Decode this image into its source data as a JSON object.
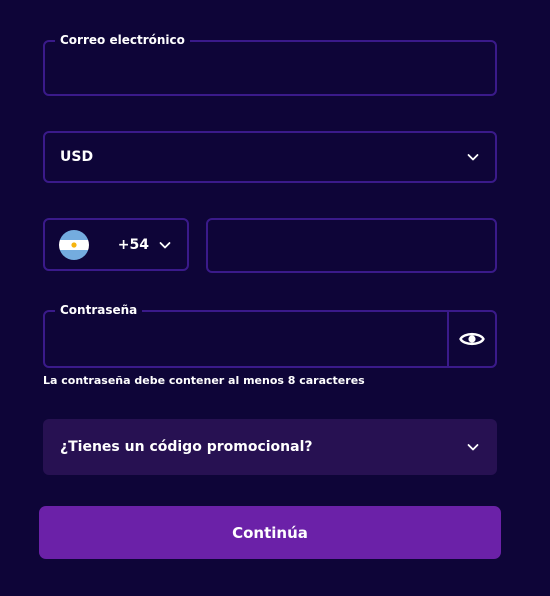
{
  "colors": {
    "background": "#0e0538",
    "field_border": "#3a1a8a",
    "promo_background": "#271152",
    "primary_button": "#6b21a8",
    "text": "#ffffff"
  },
  "email": {
    "label": "Correo electrónico",
    "value": ""
  },
  "currency": {
    "selected": "USD",
    "icon": "chevron-down-icon"
  },
  "phone": {
    "country_flag": "argentina-flag-icon",
    "dial_code": "+54",
    "number": ""
  },
  "password": {
    "label": "Contraseña",
    "value": "",
    "toggle_icon": "eye-icon",
    "hint": "La contraseña debe contener al menos 8 caracteres"
  },
  "promo": {
    "label": "¿Tienes un código promocional?",
    "icon": "chevron-down-icon"
  },
  "submit": {
    "label": "Continúa"
  }
}
